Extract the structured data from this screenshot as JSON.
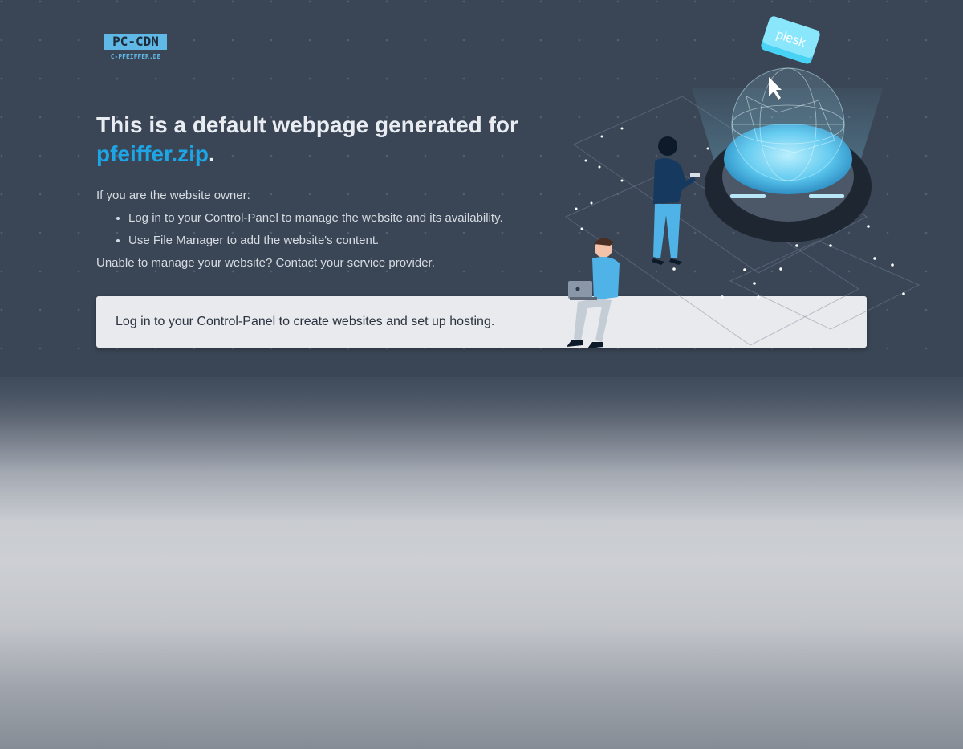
{
  "logo": {
    "title": "PC-CDN",
    "subtitle": "C-PFEIFFER.DE"
  },
  "headline": {
    "prefix": "This is a default webpage generated for",
    "domain": "pfeiffer.zip",
    "suffix": "."
  },
  "owner": {
    "intro": "If you are the website owner:",
    "items": [
      "Log in to your Control-Panel to manage the website and its availability.",
      "Use File Manager to add the website's content."
    ],
    "outro": "Unable to manage your website? Contact your service provider."
  },
  "cta": {
    "text": "Log in to your Control-Panel to create websites and set up hosting."
  },
  "illustration": {
    "badge": "plesk"
  },
  "colors": {
    "accent": "#1ea5e6",
    "background": "#3a4656",
    "logo": "#5fb8e6"
  }
}
